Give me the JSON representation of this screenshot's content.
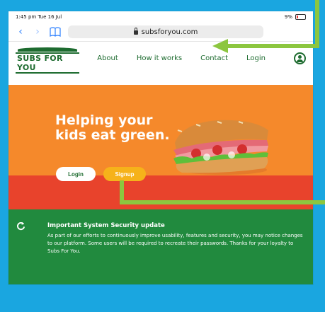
{
  "statusbar": {
    "time": "1:45 pm  Tue 16 Jul",
    "battery": "9%"
  },
  "browser": {
    "url": "subsforyou.com"
  },
  "site": {
    "logo": "SUBS FOR YOU",
    "nav": [
      "About",
      "How it works",
      "Contact",
      "Login"
    ]
  },
  "hero": {
    "headline_line1": "Helping your",
    "headline_line2": "kids eat green.",
    "login_label": "Login",
    "signup_label": "Signup"
  },
  "notice": {
    "title": "Important System Security update",
    "body": "As part of our efforts to continuously improve usability, features and security, you may notice changes to our platform. Some users will be required to recreate their passwords. Thanks for your loyalty to Subs For You."
  },
  "colors": {
    "background": "#1aa6e0",
    "brand_green": "#1d6b2f",
    "hero_orange": "#f5892b",
    "hero_red": "#e8432c",
    "signup_yellow": "#f6b21a",
    "notice_green": "#218a3e",
    "annotation_arrow": "#8cc63f"
  },
  "icons": [
    "back-icon",
    "forward-icon",
    "bookmarks-icon",
    "lock-icon",
    "user-icon",
    "refresh-icon"
  ]
}
